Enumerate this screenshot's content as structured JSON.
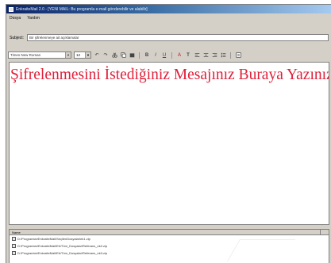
{
  "window": {
    "title": "EnkraiteMail 2.0 - [YENI MAIL: Bu programla e-mail gönderebilir ve alabilir]"
  },
  "menu": {
    "items": [
      {
        "label": "Dosya"
      },
      {
        "label": "Yardım"
      }
    ]
  },
  "subject": {
    "label": "Subject:",
    "value": "Bir şifrelenmeye ait açıklamalar"
  },
  "toolbar": {
    "font_family": "Times New Roman",
    "font_size": "12",
    "icons": [
      "undo-icon",
      "redo-icon",
      "cut-icon",
      "copy-icon",
      "paste-icon",
      "bold-icon",
      "italic-icon",
      "underline-icon",
      "font-color-icon",
      "text-icon",
      "align-left-icon",
      "align-center-icon",
      "align-right-icon",
      "bullets-icon",
      "insert-icon"
    ]
  },
  "editor": {
    "text": "Şifrelenmesini İstediğiniz Mesajınız Buraya Yazınız",
    "text_color": "#e0203a"
  },
  "attachments": {
    "header": "Name",
    "files": [
      "D:\\Programlar\\EnkraiteMail\\SeçilenDosyalar\\ek1.zip",
      "D:\\Programlar\\EnkraiteMail\\Ek\\Tüm_Dosyalar\\Referans_ek2.zip",
      "D:\\Programlar\\EnkraiteMail\\Ek\\Tüm_Dosyalar\\Referans_ek3.zip"
    ]
  }
}
